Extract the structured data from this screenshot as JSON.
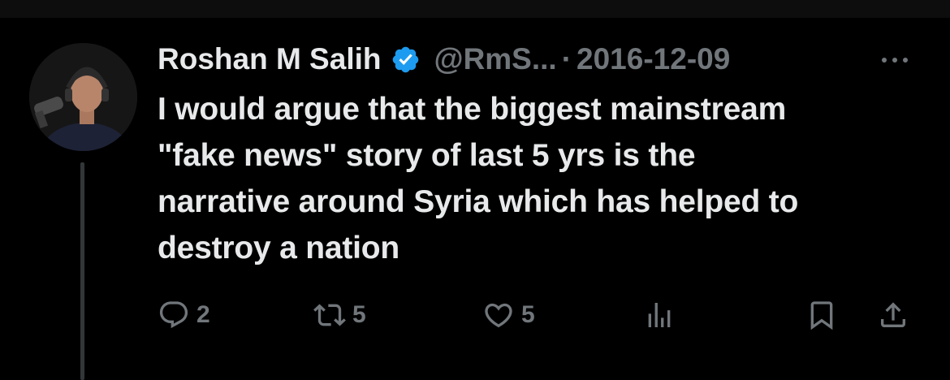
{
  "tweet": {
    "author_name": "Roshan M Salih",
    "handle": "@RmS...",
    "separator": "·",
    "date": "2016-12-09",
    "text": "I would argue that the biggest mainstream\n\"fake news\" story of last 5 yrs is the\nnarrative around Syria which has helped to\ndestroy a nation",
    "verified": true
  },
  "actions": {
    "replies": "2",
    "retweets": "5",
    "likes": "5"
  },
  "icons": {
    "verified": "verified-badge-icon",
    "more": "more-options-icon",
    "reply": "reply-icon",
    "retweet": "retweet-icon",
    "like": "heart-icon",
    "views": "analytics-icon",
    "bookmark": "bookmark-icon",
    "share": "share-icon"
  },
  "colors": {
    "background": "#000000",
    "text": "#e7e9ea",
    "muted": "#71767b",
    "verified": "#1d9bf0"
  }
}
